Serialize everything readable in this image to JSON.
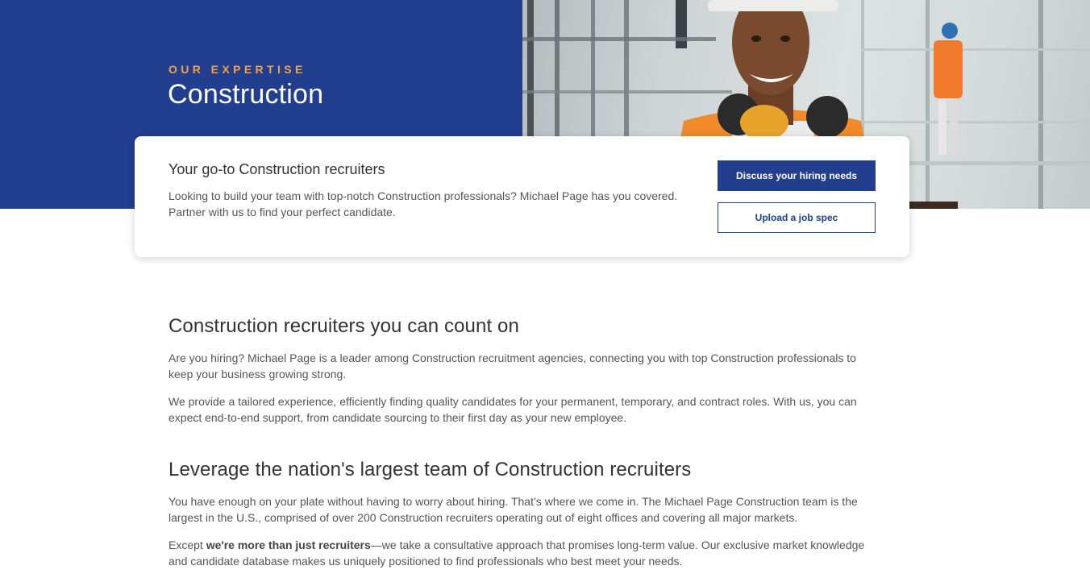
{
  "hero": {
    "eyebrow": "OUR EXPERTISE",
    "title": "Construction"
  },
  "card": {
    "title": "Your go-to Construction recruiters",
    "text": "Looking to build your team with top-notch Construction professionals? Michael Page has you covered. Partner with us to find your perfect candidate.",
    "primary_button": "Discuss your hiring needs",
    "secondary_button": "Upload a job spec"
  },
  "section1": {
    "heading": "Construction recruiters you can count on",
    "p1": "Are you hiring? Michael Page is a leader among Construction recruitment agencies, connecting you with top Construction professionals to keep your business growing strong.",
    "p2": "We provide a tailored experience, efficiently finding quality candidates for your permanent, temporary, and contract roles. With us, you can expect end-to-end support, from candidate sourcing to their first day as your new employee."
  },
  "section2": {
    "heading": "Leverage the nation's largest team of Construction recruiters",
    "p1": "You have enough on your plate without having to worry about hiring. That’s where we come in. The Michael Page Construction team is the largest in the U.S., comprised of over 200 Construction recruiters operating out of eight offices and covering all major markets.",
    "p2_prefix": "Except ",
    "p2_bold": "we're more than just recruiters",
    "p2_suffix": "—we take a consultative approach that promises long-term value. Our exclusive market knowledge and candidate database makes us uniquely positioned to find professionals who best meet your needs."
  },
  "colors": {
    "brand_blue": "#213e8f",
    "accent_orange": "#f2a33a"
  }
}
